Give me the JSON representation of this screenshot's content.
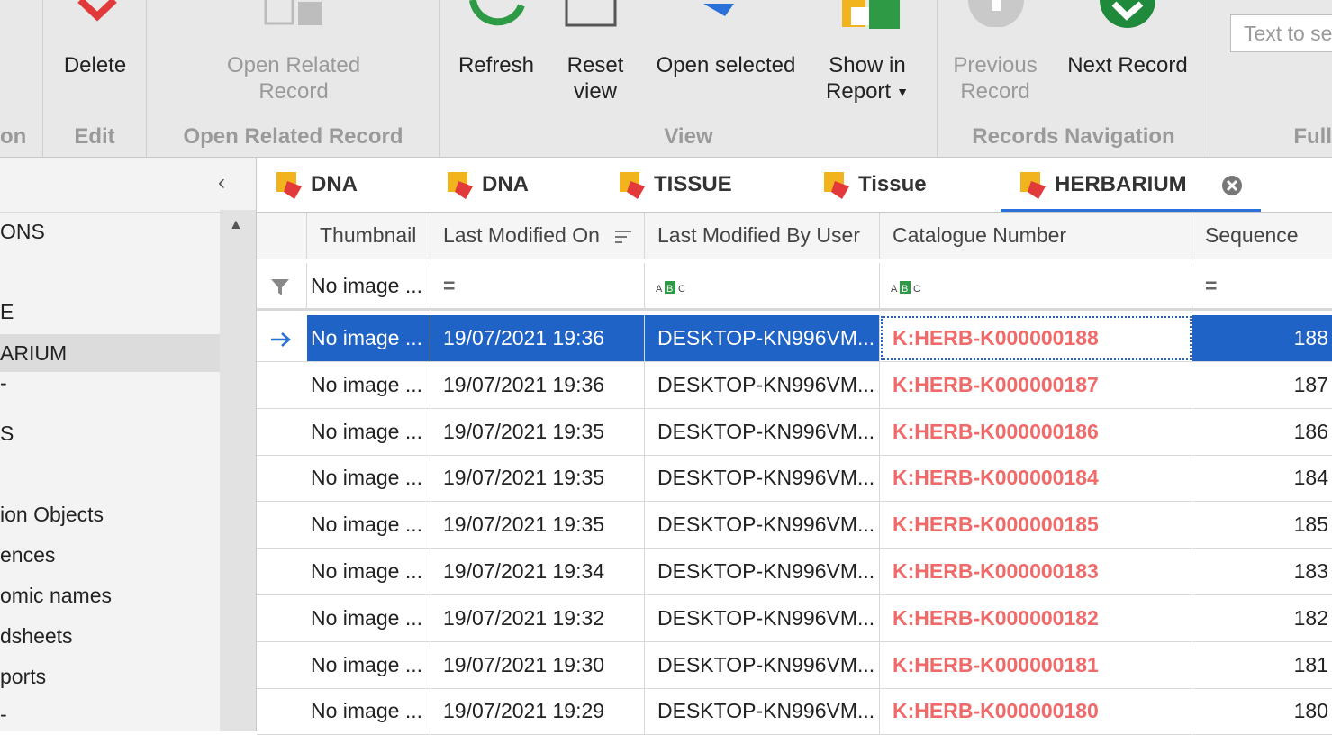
{
  "ribbon": {
    "groups": {
      "action": "on",
      "edit": "Edit",
      "open_related": "Open Related Record",
      "view": "View",
      "records_navigation": "Records Navigation",
      "full": "Full"
    },
    "buttons": {
      "delete": "Delete",
      "open_related_1": "Open Related",
      "open_related_2": "Record",
      "refresh": "Refresh",
      "reset_1": "Reset",
      "reset_2": "view",
      "open_selected": "Open selected",
      "show_report_1": "Show in",
      "show_report_2": "Report",
      "prev_1": "Previous",
      "prev_2": "Record",
      "next": "Next Record"
    },
    "search_placeholder": "Text to se"
  },
  "sidebar": {
    "items": [
      "ONS",
      "E",
      "ARIUM",
      "-",
      "S",
      "ion Objects",
      "ences",
      "omic names",
      "dsheets",
      "ports",
      "-"
    ]
  },
  "tabs": [
    {
      "label": "DNA"
    },
    {
      "label": "DNA"
    },
    {
      "label": "TISSUE"
    },
    {
      "label": "Tissue"
    },
    {
      "label": "HERBARIUM",
      "active": true
    }
  ],
  "grid": {
    "columns": [
      "Thumbnail",
      "Last Modified On",
      "Last Modified By User",
      "Catalogue Number",
      "Sequence"
    ],
    "filter": {
      "thumbnail": "No image ..."
    },
    "rows": [
      {
        "thumb": "No image ...",
        "date": "19/07/2021 19:36",
        "user": "DESKTOP-KN996VM...",
        "cat": "K:HERB-K000000188",
        "seq": "188"
      },
      {
        "thumb": "No image ...",
        "date": "19/07/2021 19:36",
        "user": "DESKTOP-KN996VM...",
        "cat": "K:HERB-K000000187",
        "seq": "187"
      },
      {
        "thumb": "No image ...",
        "date": "19/07/2021 19:35",
        "user": "DESKTOP-KN996VM...",
        "cat": "K:HERB-K000000186",
        "seq": "186"
      },
      {
        "thumb": "No image ...",
        "date": "19/07/2021 19:35",
        "user": "DESKTOP-KN996VM...",
        "cat": "K:HERB-K000000184",
        "seq": "184"
      },
      {
        "thumb": "No image ...",
        "date": "19/07/2021 19:35",
        "user": "DESKTOP-KN996VM...",
        "cat": "K:HERB-K000000185",
        "seq": "185"
      },
      {
        "thumb": "No image ...",
        "date": "19/07/2021 19:34",
        "user": "DESKTOP-KN996VM...",
        "cat": "K:HERB-K000000183",
        "seq": "183"
      },
      {
        "thumb": "No image ...",
        "date": "19/07/2021 19:32",
        "user": "DESKTOP-KN996VM...",
        "cat": "K:HERB-K000000182",
        "seq": "182"
      },
      {
        "thumb": "No image ...",
        "date": "19/07/2021 19:30",
        "user": "DESKTOP-KN996VM...",
        "cat": "K:HERB-K000000181",
        "seq": "181"
      },
      {
        "thumb": "No image ...",
        "date": "19/07/2021 19:29",
        "user": "DESKTOP-KN996VM...",
        "cat": "K:HERB-K000000180",
        "seq": "180"
      }
    ]
  },
  "colors": {
    "accent": "#1e63c5",
    "catalogue_text": "#f06a6a",
    "refresh_green": "#2e9a45",
    "delete_red": "#e23a3a"
  }
}
